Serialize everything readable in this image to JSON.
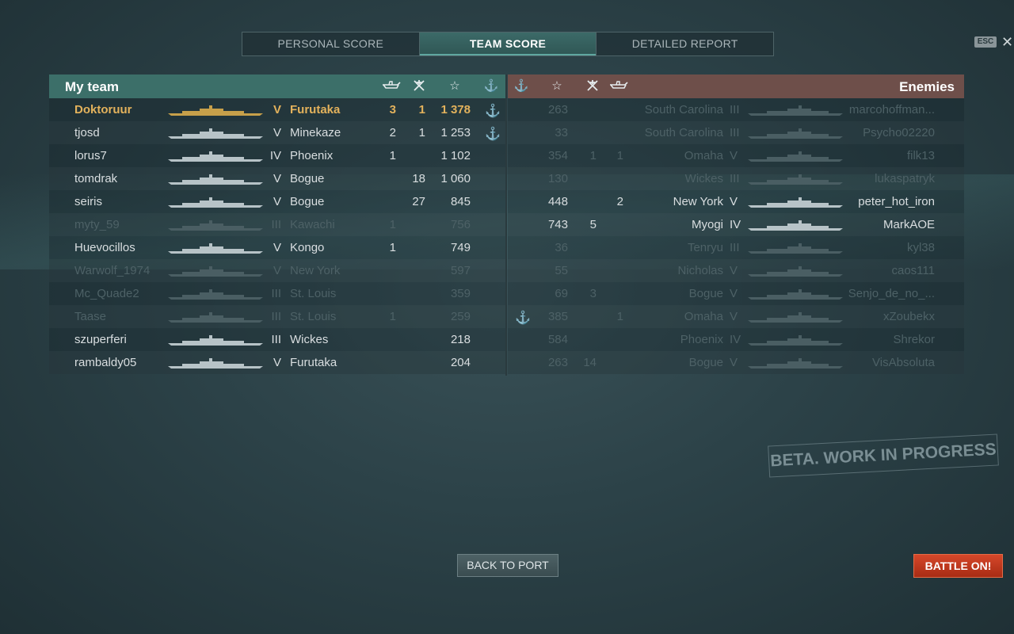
{
  "tabs": [
    {
      "label": "PERSONAL SCORE",
      "active": false
    },
    {
      "label": "TEAM SCORE",
      "active": true
    },
    {
      "label": "DETAILED REPORT",
      "active": false
    }
  ],
  "esc_label": "ESC",
  "close_glyph": "✕",
  "my_team": {
    "title": "My team",
    "header_icons": [
      "ship-sunk-icon",
      "planes-shot-icon",
      "star-icon",
      "anchor-icon"
    ],
    "rows": [
      {
        "player": "Doktoruur",
        "tier": "V",
        "ship": "Furutaka",
        "kills": "3",
        "planes": "1",
        "xp": "1 378",
        "anchor": "⚓",
        "state": "me"
      },
      {
        "player": "tjosd",
        "tier": "V",
        "ship": "Minekaze",
        "kills": "2",
        "planes": "1",
        "xp": "1 253",
        "anchor": "⚓",
        "state": "alive"
      },
      {
        "player": "lorus7",
        "tier": "IV",
        "ship": "Phoenix",
        "kills": "1",
        "planes": "",
        "xp": "1 102",
        "anchor": "",
        "state": "alive"
      },
      {
        "player": "tomdrak",
        "tier": "V",
        "ship": "Bogue",
        "kills": "",
        "planes": "18",
        "xp": "1 060",
        "anchor": "",
        "state": "alive"
      },
      {
        "player": "seiris",
        "tier": "V",
        "ship": "Bogue",
        "kills": "",
        "planes": "27",
        "xp": "845",
        "anchor": "",
        "state": "alive"
      },
      {
        "player": "myty_59",
        "tier": "III",
        "ship": "Kawachi",
        "kills": "1",
        "planes": "",
        "xp": "756",
        "anchor": "",
        "state": "dead"
      },
      {
        "player": "Huevocillos",
        "tier": "V",
        "ship": "Kongo",
        "kills": "1",
        "planes": "",
        "xp": "749",
        "anchor": "",
        "state": "alive"
      },
      {
        "player": "Warwolf_1974",
        "tier": "V",
        "ship": "New York",
        "kills": "",
        "planes": "",
        "xp": "597",
        "anchor": "",
        "state": "dead"
      },
      {
        "player": "Mc_Quade2",
        "tier": "III",
        "ship": "St. Louis",
        "kills": "",
        "planes": "",
        "xp": "359",
        "anchor": "",
        "state": "dead"
      },
      {
        "player": "Taase",
        "tier": "III",
        "ship": "St. Louis",
        "kills": "1",
        "planes": "",
        "xp": "259",
        "anchor": "",
        "state": "dead"
      },
      {
        "player": "szuperferi",
        "tier": "III",
        "ship": "Wickes",
        "kills": "",
        "planes": "",
        "xp": "218",
        "anchor": "",
        "state": "alive"
      },
      {
        "player": "rambaldy05",
        "tier": "V",
        "ship": "Furutaka",
        "kills": "",
        "planes": "",
        "xp": "204",
        "anchor": "",
        "state": "alive"
      }
    ]
  },
  "enemies": {
    "title": "Enemies",
    "header_icons": [
      "anchor-icon",
      "star-icon",
      "planes-shot-icon",
      "ship-sunk-icon"
    ],
    "rows": [
      {
        "anchor": "",
        "xp": "263",
        "planes": "",
        "kills": "",
        "ship": "South Carolina",
        "tier": "III",
        "player": "marcohoffman...",
        "state": "dead"
      },
      {
        "anchor": "",
        "xp": "33",
        "planes": "",
        "kills": "",
        "ship": "South Carolina",
        "tier": "III",
        "player": "Psycho02220",
        "state": "dead"
      },
      {
        "anchor": "",
        "xp": "354",
        "planes": "1",
        "kills": "1",
        "ship": "Omaha",
        "tier": "V",
        "player": "filk13",
        "state": "dead"
      },
      {
        "anchor": "",
        "xp": "130",
        "planes": "",
        "kills": "",
        "ship": "Wickes",
        "tier": "III",
        "player": "lukaspatryk",
        "state": "dead"
      },
      {
        "anchor": "",
        "xp": "448",
        "planes": "",
        "kills": "2",
        "ship": "New York",
        "tier": "V",
        "player": "peter_hot_iron",
        "state": "alive"
      },
      {
        "anchor": "",
        "xp": "743",
        "planes": "5",
        "kills": "",
        "ship": "Myogi",
        "tier": "IV",
        "player": "MarkAOE",
        "state": "alive"
      },
      {
        "anchor": "",
        "xp": "36",
        "planes": "",
        "kills": "",
        "ship": "Tenryu",
        "tier": "III",
        "player": "kyl38",
        "state": "dead"
      },
      {
        "anchor": "",
        "xp": "55",
        "planes": "",
        "kills": "",
        "ship": "Nicholas",
        "tier": "V",
        "player": "caos111",
        "state": "dead"
      },
      {
        "anchor": "",
        "xp": "69",
        "planes": "3",
        "kills": "",
        "ship": "Bogue",
        "tier": "V",
        "player": "Senjo_de_no_...",
        "state": "dead"
      },
      {
        "anchor": "⚓",
        "xp": "385",
        "planes": "",
        "kills": "1",
        "ship": "Omaha",
        "tier": "V",
        "player": "xZoubekx",
        "state": "dead"
      },
      {
        "anchor": "",
        "xp": "584",
        "planes": "",
        "kills": "",
        "ship": "Phoenix",
        "tier": "IV",
        "player": "Shrekor",
        "state": "dead"
      },
      {
        "anchor": "",
        "xp": "263",
        "planes": "14",
        "kills": "",
        "ship": "Bogue",
        "tier": "V",
        "player": "VisAbsoluta",
        "state": "dead"
      }
    ]
  },
  "watermark": "BETA. WORK IN PROGRESS",
  "buttons": {
    "back": "BACK TO PORT",
    "battle": "BATTLE ON!"
  }
}
